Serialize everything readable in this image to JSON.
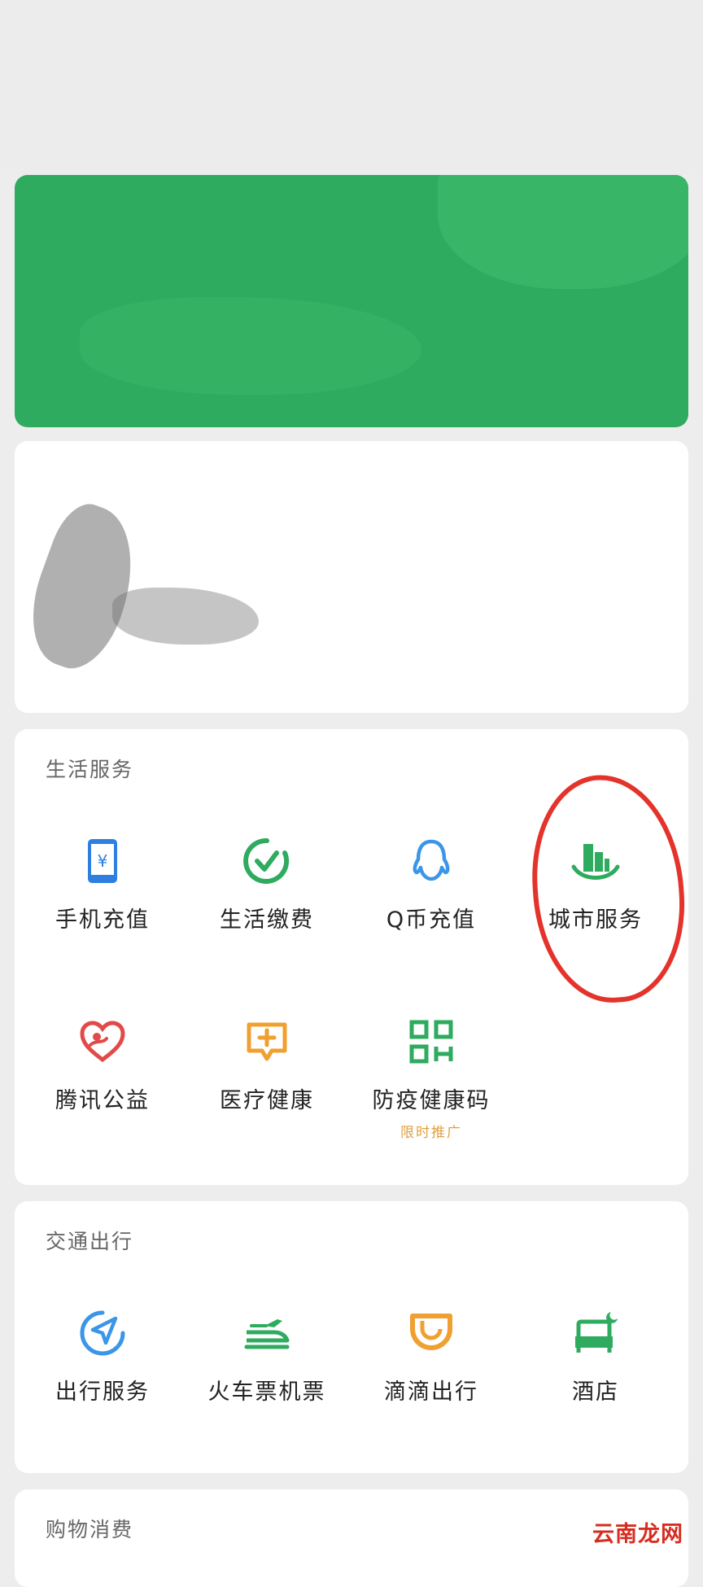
{
  "life_services": {
    "title": "生活服务",
    "items": [
      {
        "label": "手机充值",
        "icon": "phone-recharge-icon",
        "color": "#2f7fe0"
      },
      {
        "label": "生活缴费",
        "icon": "check-circle-icon",
        "color": "#2eab5e"
      },
      {
        "label": "Q币充值",
        "icon": "qq-penguin-icon",
        "color": "#3b95e8"
      },
      {
        "label": "城市服务",
        "icon": "city-buildings-icon",
        "color": "#2eab5e"
      },
      {
        "label": "腾讯公益",
        "icon": "heart-icon",
        "color": "#e24a4a"
      },
      {
        "label": "医疗健康",
        "icon": "medical-chat-icon",
        "color": "#f0a030"
      },
      {
        "label": "防疫健康码",
        "icon": "qr-code-icon",
        "color": "#2eab5e",
        "sub": "限时推广"
      }
    ]
  },
  "transport": {
    "title": "交通出行",
    "items": [
      {
        "label": "出行服务",
        "icon": "navigation-icon",
        "color": "#3b95e8"
      },
      {
        "label": "火车票机票",
        "icon": "train-icon",
        "color": "#2eab5e"
      },
      {
        "label": "滴滴出行",
        "icon": "didi-icon",
        "color": "#f0a030"
      },
      {
        "label": "酒店",
        "icon": "hotel-bed-icon",
        "color": "#2eab5e"
      }
    ]
  },
  "shopping": {
    "title": "购物消费"
  },
  "watermark": "云南龙网",
  "accent_green": "#2eab5e",
  "annotation_color": "#e4332a"
}
